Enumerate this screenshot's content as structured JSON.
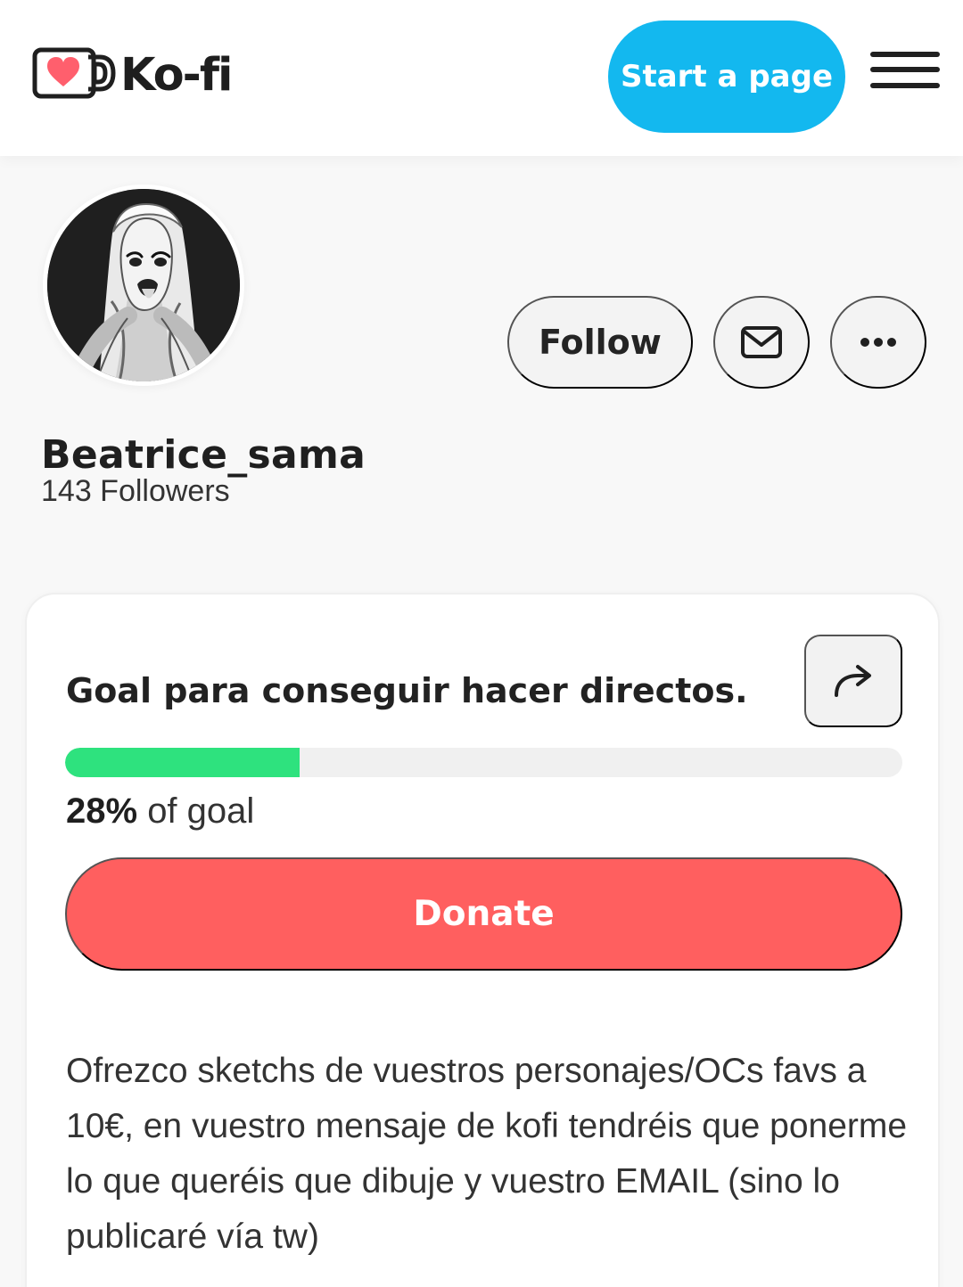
{
  "header": {
    "brand": "Ko-fi",
    "start_page_label": "Start a page",
    "menu_icon": "hamburger-menu-icon"
  },
  "profile": {
    "username": "Beatrice_sama",
    "followers": "143 Followers",
    "follow_label": "Follow",
    "message_icon": "envelope-icon",
    "more_icon": "more-dots-icon"
  },
  "goal": {
    "title": "Goal para conseguir hacer directos.",
    "share_icon": "share-arrow-icon",
    "progress_percent": "28%",
    "progress_suffix": "of goal",
    "progress_value": 0.28,
    "donate_label": "Donate",
    "description": "Ofrezco sketchs de vuestros personajes/OCs favs a 10€, en vuestro mensaje de kofi tendréis que ponerme lo que queréis que dibuje y vuestro EMAIL (sino lo publicaré vía tw)"
  },
  "colors": {
    "start_page": "#13b8ef",
    "progress": "#2ee27e",
    "donate": "#ff5f5f",
    "logo_heart": "#ff5f6d"
  }
}
